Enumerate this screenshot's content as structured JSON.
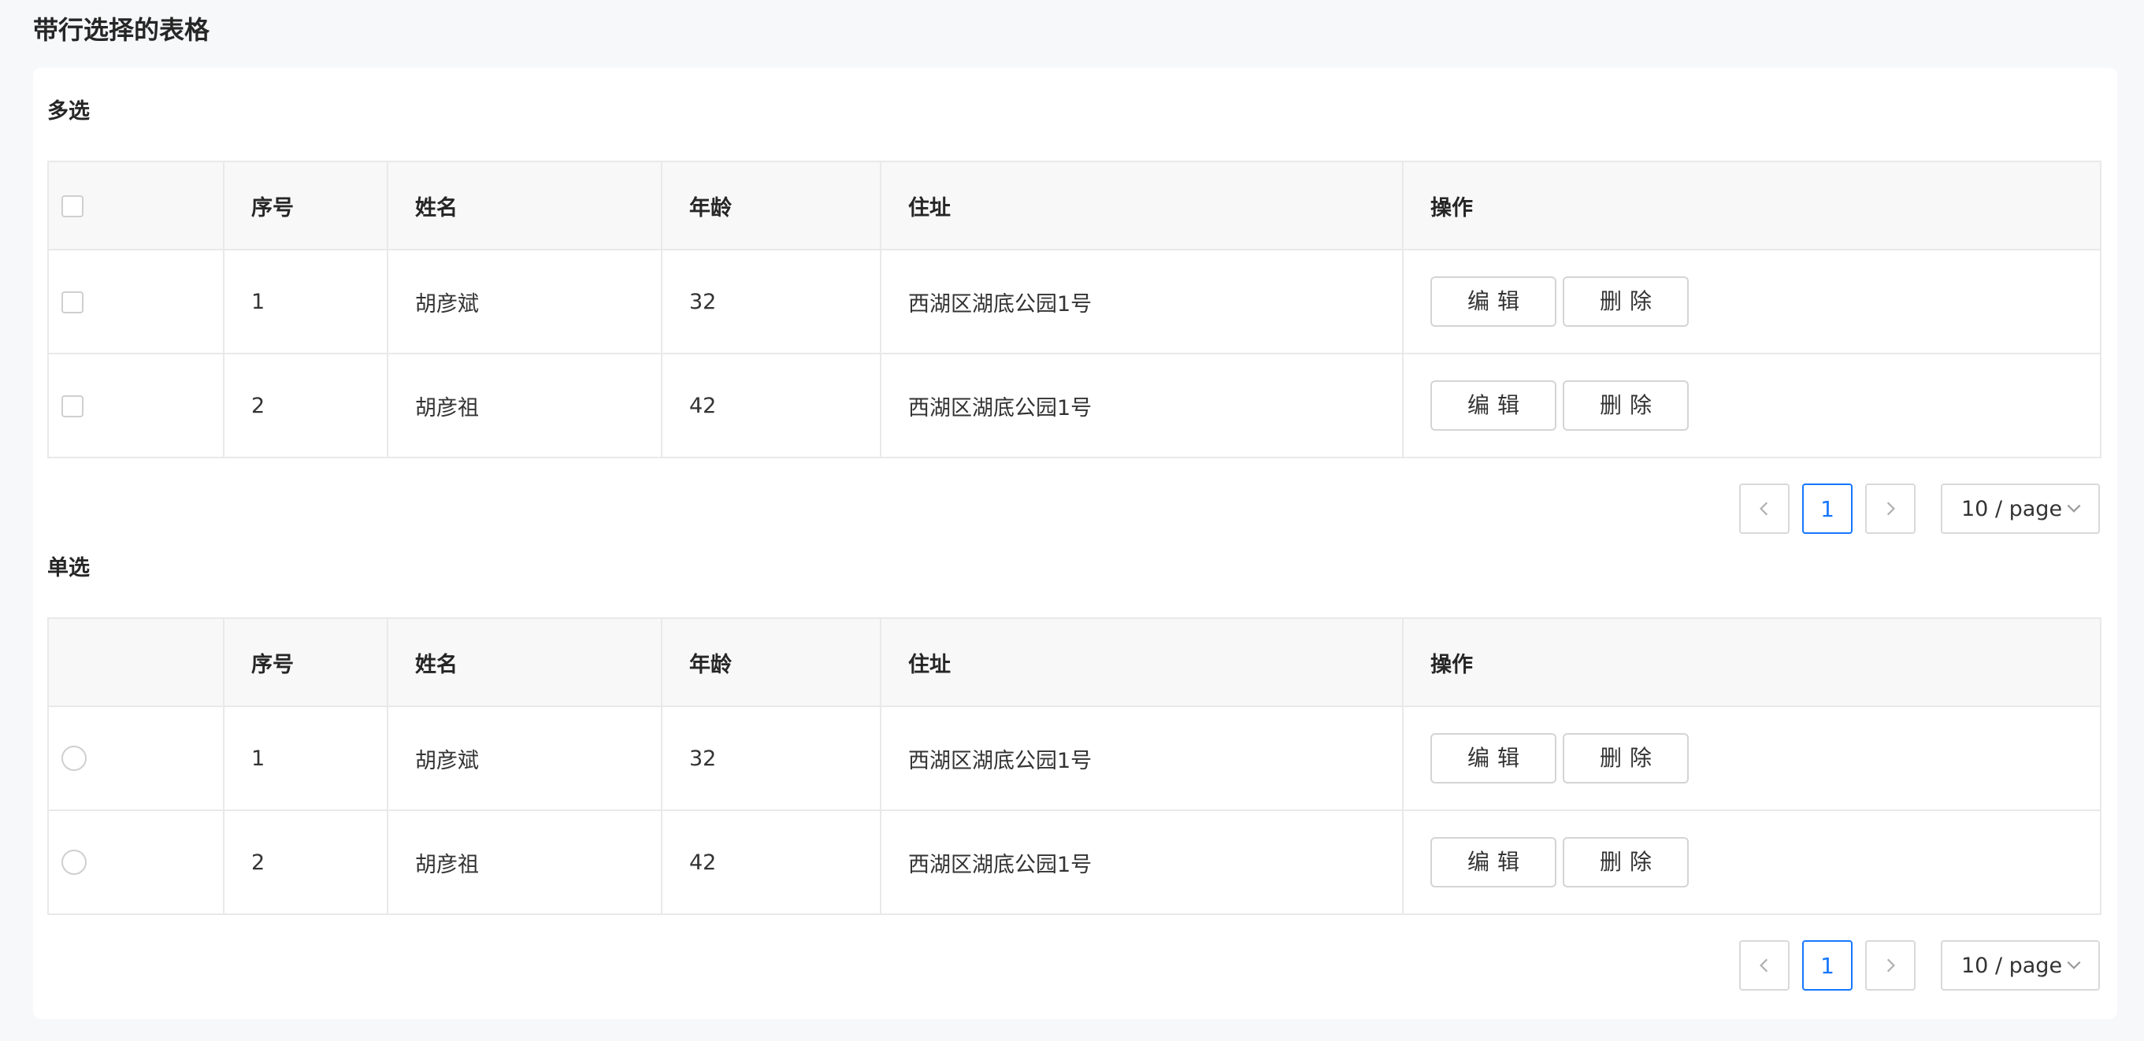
{
  "page_title": "带行选择的表格",
  "sections": [
    {
      "title": "多选",
      "columns": [
        "序号",
        "姓名",
        "年龄",
        "住址",
        "操作"
      ],
      "rows": [
        {
          "index": "1",
          "name": "胡彦斌",
          "age": "32",
          "address": "西湖区湖底公园1号"
        },
        {
          "index": "2",
          "name": "胡彦祖",
          "age": "42",
          "address": "西湖区湖底公园1号"
        }
      ],
      "actions": {
        "edit": "编辑",
        "delete": "删除"
      },
      "pagination": {
        "current_page": "1",
        "page_size": "10 / page"
      }
    },
    {
      "title": "单选",
      "columns": [
        "序号",
        "姓名",
        "年龄",
        "住址",
        "操作"
      ],
      "rows": [
        {
          "index": "1",
          "name": "胡彦斌",
          "age": "32",
          "address": "西湖区湖底公园1号"
        },
        {
          "index": "2",
          "name": "胡彦祖",
          "age": "42",
          "address": "西湖区湖底公园1号"
        }
      ],
      "actions": {
        "edit": "编辑",
        "delete": "删除"
      },
      "pagination": {
        "current_page": "1",
        "page_size": "10 / page"
      }
    }
  ],
  "colors": {
    "accent": "#1677ff",
    "header_bg": "#f8f8f8",
    "page_bg": "#f7f8fa",
    "border": "#e9e9e9"
  }
}
